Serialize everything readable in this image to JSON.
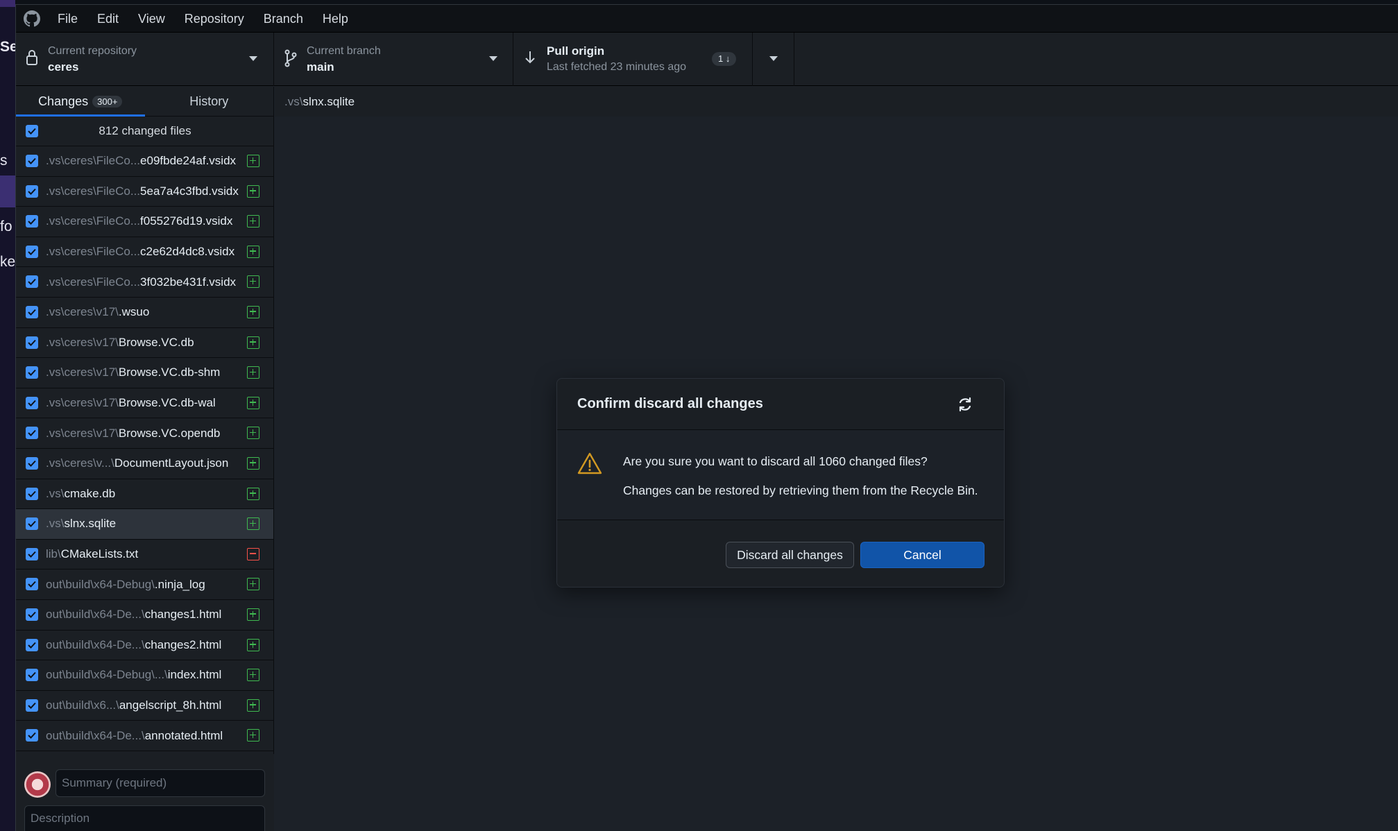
{
  "background_app": {
    "fragments": [
      "Ser",
      "s",
      "fo",
      "ke"
    ]
  },
  "menubar": {
    "items": [
      "File",
      "Edit",
      "View",
      "Repository",
      "Branch",
      "Help"
    ]
  },
  "toolbar": {
    "repo_label": "Current repository",
    "repo_value": "ceres",
    "branch_label": "Current branch",
    "branch_value": "main",
    "pull_title": "Pull origin",
    "pull_subtitle": "Last fetched 23 minutes ago",
    "pull_count": "1 ↓"
  },
  "sidebar": {
    "tabs": [
      {
        "label": "Changes",
        "badge": "300+"
      },
      {
        "label": "History"
      }
    ],
    "changed_files_label": "812 changed files",
    "files": [
      {
        "dir": ".vs\\ceres\\FileCo...",
        "name": "e09fbde24af.vsidx",
        "status": "added"
      },
      {
        "dir": ".vs\\ceres\\FileCo...",
        "name": "5ea7a4c3fbd.vsidx",
        "status": "added"
      },
      {
        "dir": ".vs\\ceres\\FileCo...",
        "name": "f055276d19.vsidx",
        "status": "added"
      },
      {
        "dir": ".vs\\ceres\\FileCo...",
        "name": "c2e62d4dc8.vsidx",
        "status": "added"
      },
      {
        "dir": ".vs\\ceres\\FileCo...",
        "name": "3f032be431f.vsidx",
        "status": "added"
      },
      {
        "dir": ".vs\\ceres\\v17\\",
        "name": ".wsuo",
        "status": "added"
      },
      {
        "dir": ".vs\\ceres\\v17\\",
        "name": "Browse.VC.db",
        "status": "added"
      },
      {
        "dir": ".vs\\ceres\\v17\\",
        "name": "Browse.VC.db-shm",
        "status": "added"
      },
      {
        "dir": ".vs\\ceres\\v17\\",
        "name": "Browse.VC.db-wal",
        "status": "added"
      },
      {
        "dir": ".vs\\ceres\\v17\\",
        "name": "Browse.VC.opendb",
        "status": "added"
      },
      {
        "dir": ".vs\\ceres\\v...\\",
        "name": "DocumentLayout.json",
        "status": "added"
      },
      {
        "dir": ".vs\\",
        "name": "cmake.db",
        "status": "added"
      },
      {
        "dir": ".vs\\",
        "name": "slnx.sqlite",
        "status": "added"
      },
      {
        "dir": "lib\\",
        "name": "CMakeLists.txt",
        "status": "deleted"
      },
      {
        "dir": "out\\build\\x64-Debug\\",
        "name": ".ninja_log",
        "status": "added"
      },
      {
        "dir": "out\\build\\x64-De...\\",
        "name": "changes1.html",
        "status": "added"
      },
      {
        "dir": "out\\build\\x64-De...\\",
        "name": "changes2.html",
        "status": "added"
      },
      {
        "dir": "out\\build\\x64-Debug\\...\\",
        "name": "index.html",
        "status": "added"
      },
      {
        "dir": "out\\build\\x6...\\",
        "name": "angelscript_8h.html",
        "status": "added"
      },
      {
        "dir": "out\\build\\x64-De...\\",
        "name": "annotated.html",
        "status": "added"
      }
    ],
    "summary_placeholder": "Summary (required)",
    "description_placeholder": "Description"
  },
  "main": {
    "path_dir": ".vs\\",
    "path_name": "slnx.sqlite"
  },
  "dialog": {
    "title": "Confirm discard all changes",
    "message": "Are you sure you want to discard all 1060 changed files?",
    "submessage": "Changes can be restored by retrieving them from the Recycle Bin.",
    "discard_label": "Discard all changes",
    "cancel_label": "Cancel"
  },
  "colors": {
    "accent": "#1f6feb",
    "checkbox": "#4493f8",
    "added": "#3fb950",
    "deleted": "#f85149",
    "warning": "#d29922"
  }
}
